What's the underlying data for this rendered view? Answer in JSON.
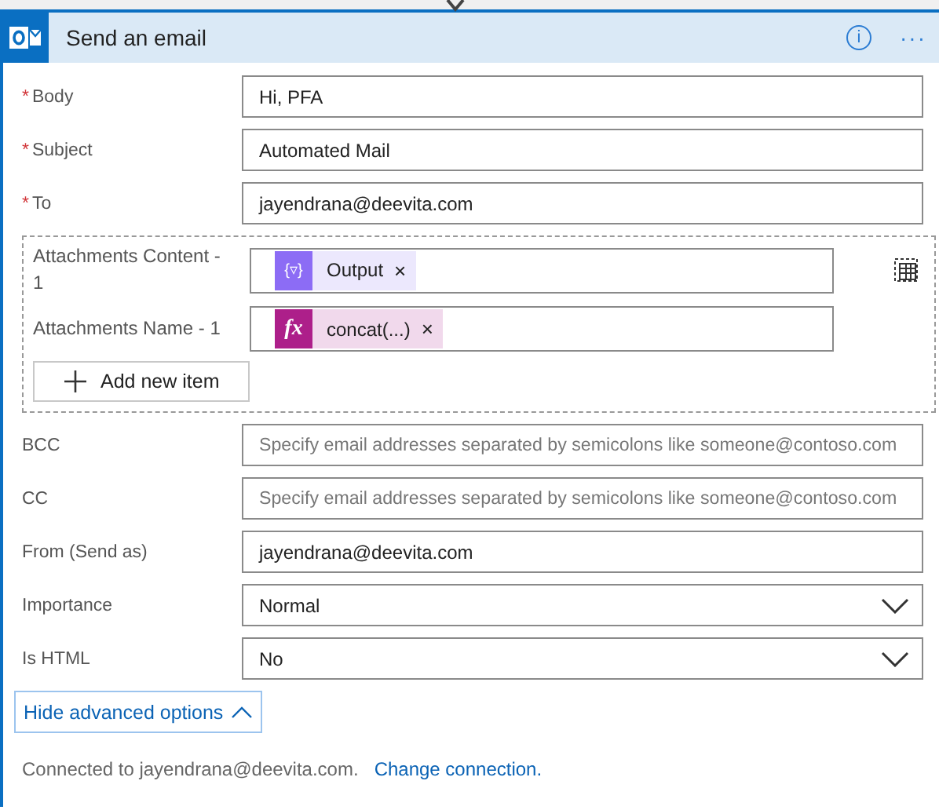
{
  "card": {
    "title": "Send an email",
    "info_icon": "i",
    "more_icon": "···"
  },
  "fields": [
    {
      "label": "Body",
      "required": true,
      "required_mark": "*",
      "value": "Hi, PFA"
    },
    {
      "label": "Subject",
      "required": true,
      "required_mark": "*",
      "value": "Automated Mail"
    },
    {
      "label": "To",
      "required": true,
      "required_mark": "*",
      "value": "jayendrana@deevita.com"
    }
  ],
  "attachments": {
    "items": [
      {
        "label": "Attachments Content - 1",
        "token": {
          "kind": "variable",
          "icon": "{▿}",
          "text": "Output",
          "remove": "×"
        }
      },
      {
        "label": "Attachments Name - 1",
        "token": {
          "kind": "expression",
          "icon": "fx",
          "text": "concat(...)",
          "remove": "×"
        }
      }
    ],
    "add_button": "Add new item"
  },
  "advanced_fields": [
    {
      "label": "BCC",
      "kind": "text",
      "placeholder": "Specify email addresses separated by semicolons like someone@contoso.com"
    },
    {
      "label": "CC",
      "kind": "text",
      "placeholder": "Specify email addresses separated by semicolons like someone@contoso.com"
    },
    {
      "label": "From (Send as)",
      "kind": "text",
      "value": "jayendrana@deevita.com"
    },
    {
      "label": "Importance",
      "kind": "dropdown",
      "value": "Normal"
    },
    {
      "label": "Is HTML",
      "kind": "dropdown",
      "value": "No"
    }
  ],
  "advanced_toggle": "Hide advanced options",
  "footer": {
    "text": "Connected to jayendrana@deevita.com.",
    "link": "Change connection."
  }
}
